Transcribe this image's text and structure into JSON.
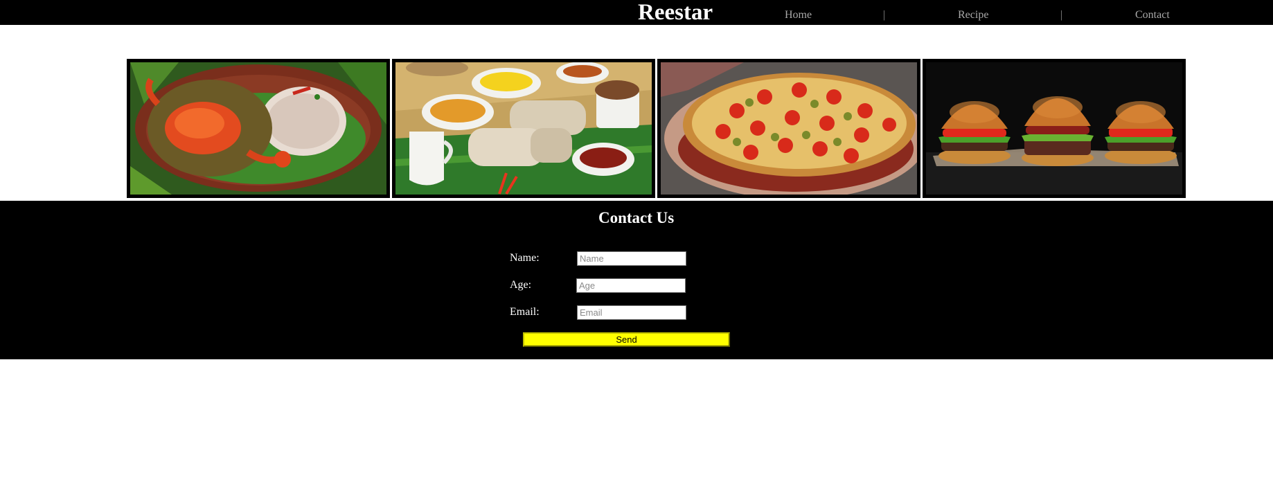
{
  "header": {
    "brand": "Reestar",
    "nav": [
      {
        "label": "Home"
      },
      {
        "label": "Recipe"
      },
      {
        "label": "Contact"
      }
    ],
    "separator": "|"
  },
  "gallery": {
    "items": [
      {
        "icon": "crab-curry-rice-photo"
      },
      {
        "icon": "puttu-curry-spread-photo"
      },
      {
        "icon": "pizza-photo"
      },
      {
        "icon": "burgers-photo"
      }
    ]
  },
  "contact": {
    "title": "Contact Us",
    "fields": {
      "name": {
        "label": "Name:",
        "value": "",
        "placeholder": "Name"
      },
      "age": {
        "label": "Age:",
        "value": "",
        "placeholder": "Age"
      },
      "email": {
        "label": "Email:",
        "value": "",
        "placeholder": "Email"
      }
    },
    "send_label": "Send"
  },
  "colors": {
    "header_bg": "#000000",
    "contact_bg": "#000000",
    "nav_text": "#a9a9a9",
    "send_button": "#ffff00"
  }
}
